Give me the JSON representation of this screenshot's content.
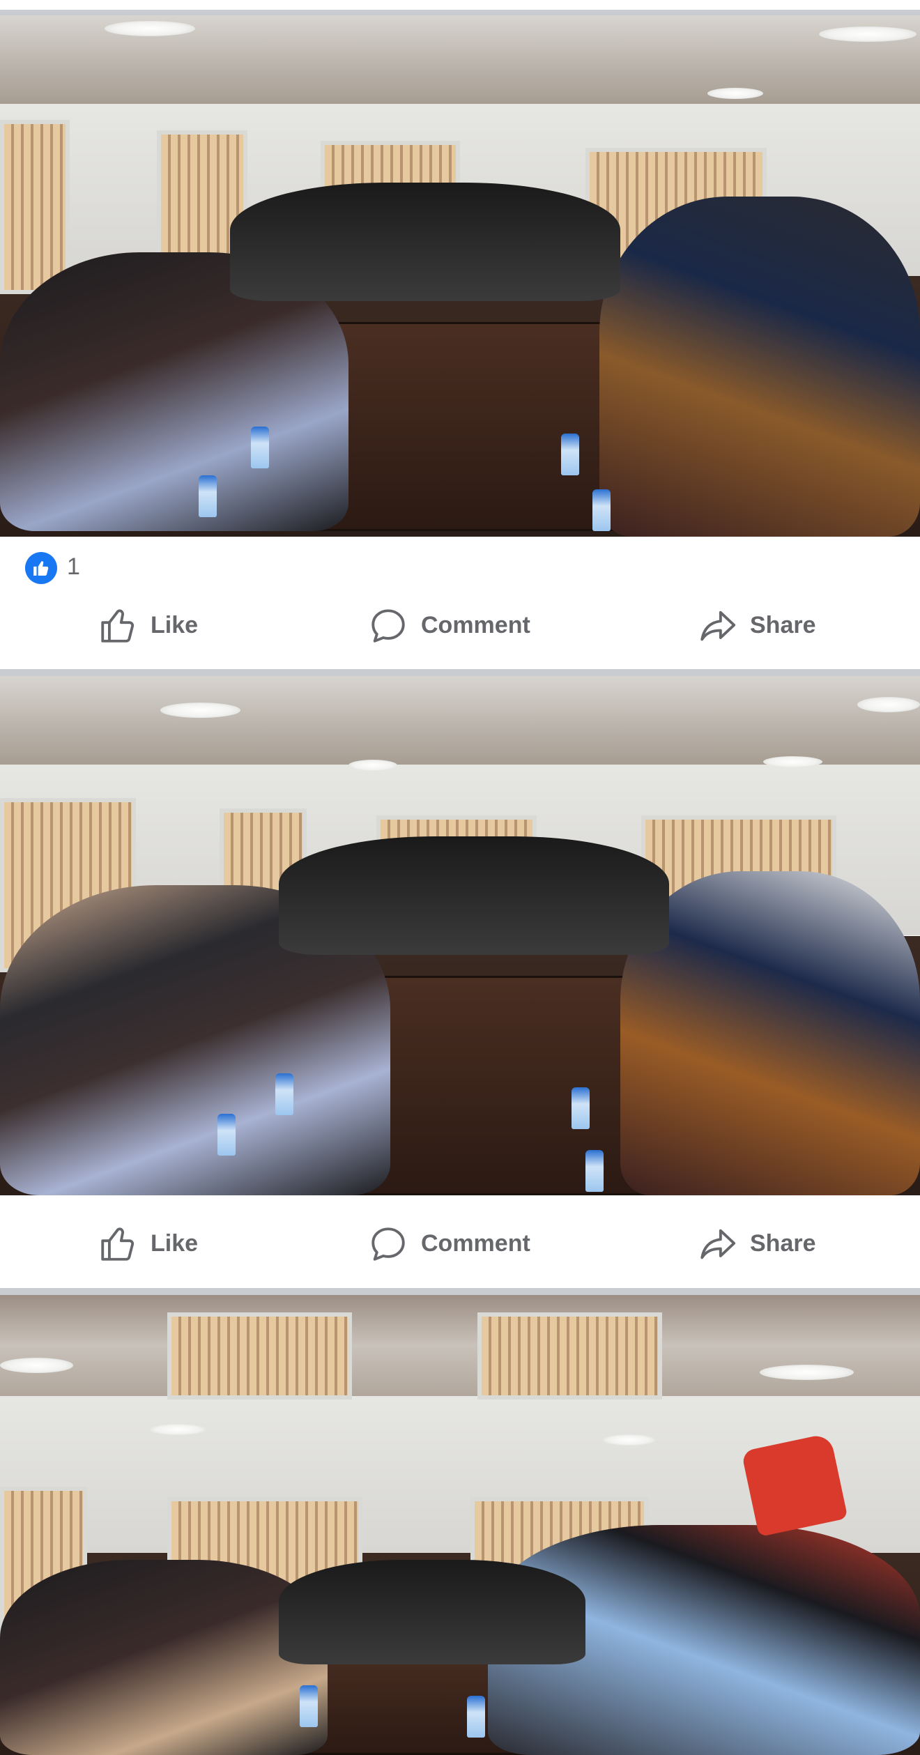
{
  "posts": [
    {
      "photo": {
        "alt_icon": "photo-meeting-room"
      },
      "reactions": {
        "count": "1",
        "icon": "like-badge-icon"
      },
      "actions": {
        "like_label": "Like",
        "comment_label": "Comment",
        "share_label": "Share"
      }
    },
    {
      "photo": {
        "alt_icon": "photo-meeting-room"
      },
      "actions": {
        "like_label": "Like",
        "comment_label": "Comment",
        "share_label": "Share"
      }
    },
    {
      "photo": {
        "alt_icon": "photo-meeting-room"
      }
    }
  ],
  "colors": {
    "accent": "#1877f2",
    "text_secondary": "#65676b",
    "divider": "#c9ccd1"
  }
}
